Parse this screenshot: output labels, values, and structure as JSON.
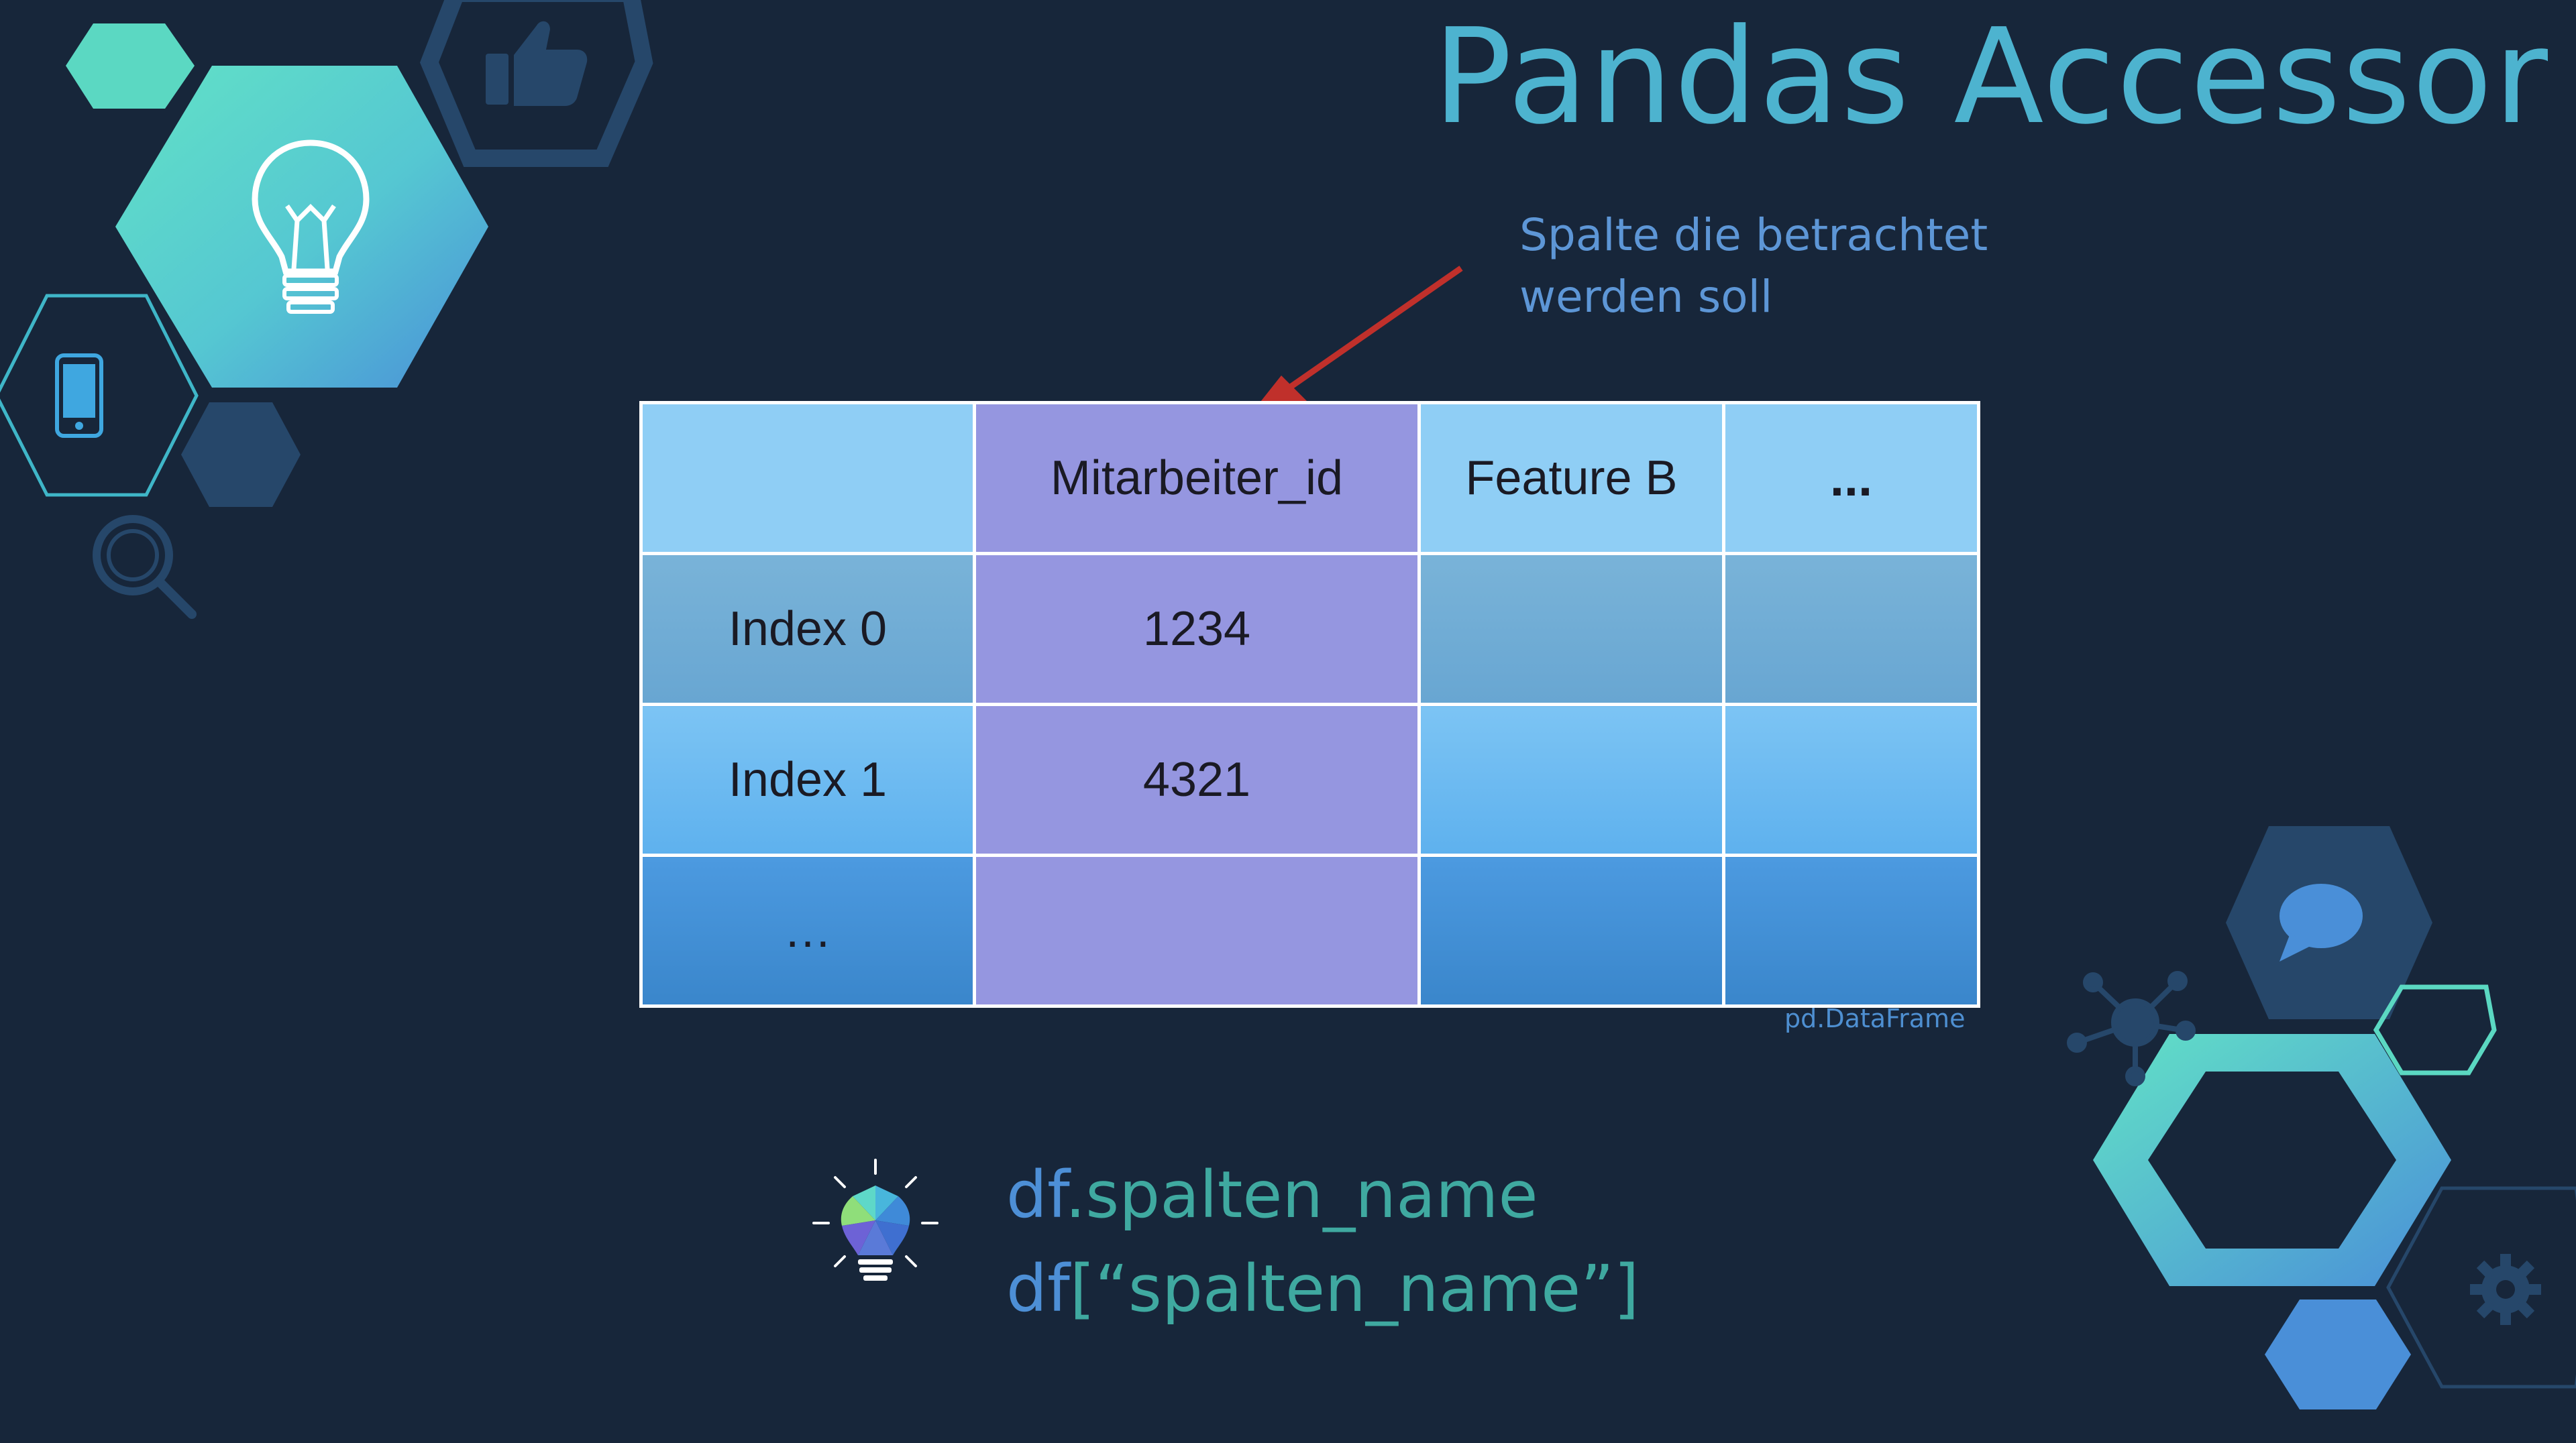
{
  "slide": {
    "title": "Pandas Accessor",
    "annotation": {
      "line1": "Spalte die betrachtet",
      "line2": "werden soll"
    },
    "table": {
      "header": [
        "",
        "Mitarbeiter_id",
        "Feature B",
        "..."
      ],
      "rows": [
        [
          "Index 0",
          "1234",
          "",
          ""
        ],
        [
          "Index 1",
          "4321",
          "",
          ""
        ],
        [
          "…",
          "",
          "",
          ""
        ]
      ],
      "caption": "pd.DataFrame"
    },
    "code": {
      "line1_prefix": "df",
      "line1_suffix": ".spalten_name",
      "line2_prefix": "df",
      "line2_suffix": "[“spalten_name”]"
    }
  },
  "colors": {
    "background": "#17263a",
    "title": "#4db3cf",
    "annotation": "#5d96d6",
    "highlight_column": "#9596e0",
    "arrow": "#c0302b",
    "teal": "#5ed8c8",
    "blue": "#4a8fd8",
    "navy_hex": "#26476a"
  },
  "icons": [
    "lightbulb-icon",
    "thumbs-up-icon",
    "smartphone-icon",
    "magnifier-icon",
    "chat-bubble-icon",
    "network-hub-icon",
    "gear-icon",
    "colorful-lightbulb-icon"
  ]
}
